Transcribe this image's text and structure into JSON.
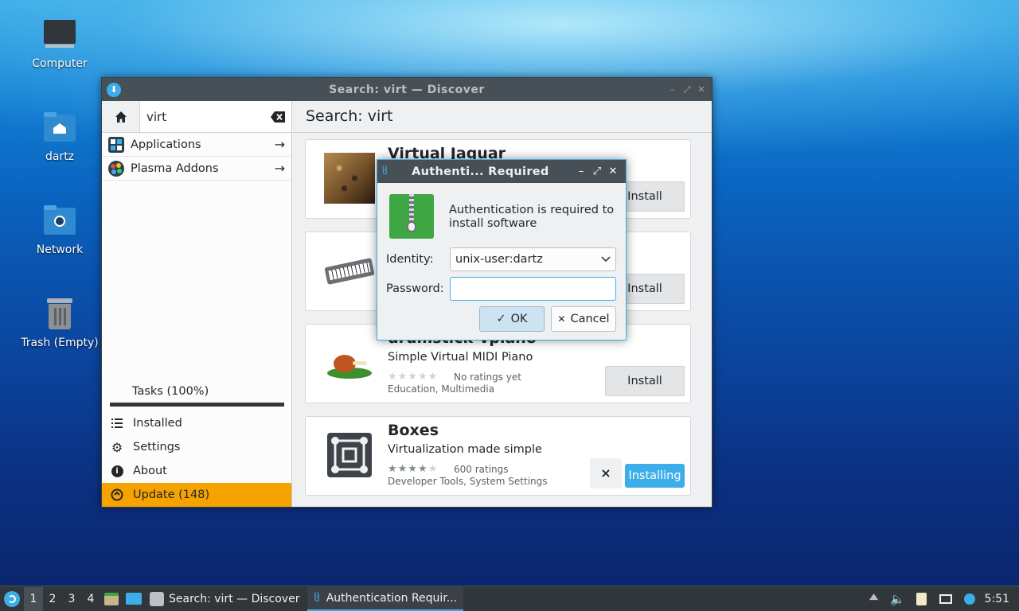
{
  "desktop": {
    "icons": [
      {
        "label": "Computer"
      },
      {
        "label": "dartz"
      },
      {
        "label": "Network"
      },
      {
        "label": "Trash (Empty)"
      }
    ]
  },
  "discover": {
    "title": "Search: virt — Discover",
    "search_value": "virt",
    "header": "Search: virt",
    "categories": [
      {
        "label": "Applications",
        "icon": "applications-icon"
      },
      {
        "label": "Plasma Addons",
        "icon": "plasma-addons-icon"
      }
    ],
    "tasks": "Tasks (100%)",
    "tasks_progress": 1.0,
    "menu": {
      "installed": "Installed",
      "settings": "Settings",
      "about": "About",
      "update": "Update (148)"
    },
    "apps": [
      {
        "name": "Virtual Jaguar",
        "button": "Install"
      },
      {
        "name": "",
        "button": "Install"
      },
      {
        "name": "drumstick-vpiano",
        "description": "Simple Virtual MIDI Piano",
        "rating": "No ratings yet",
        "stars": 0,
        "categories": "Education, Multimedia",
        "button": "Install"
      },
      {
        "name": "Boxes",
        "description": "Virtualization made simple",
        "rating": "600 ratings",
        "stars": 4,
        "categories": "Developer Tools, System Settings",
        "button": "Installing",
        "cancel": "×"
      }
    ],
    "accent": "#3daee9",
    "update_bg": "#f6a300"
  },
  "auth": {
    "title": "Authenti... Required",
    "message": "Authentication is required to install software",
    "identity_label": "Identity:",
    "identity_value": "unix-user:dartz",
    "password_label": "Password:",
    "password_value": "",
    "ok": "OK",
    "cancel": "Cancel"
  },
  "taskbar": {
    "desktops": [
      "1",
      "2",
      "3",
      "4"
    ],
    "tasks": [
      "Search: virt — Discover",
      "Authentication Requir..."
    ],
    "clock": "5:51"
  }
}
